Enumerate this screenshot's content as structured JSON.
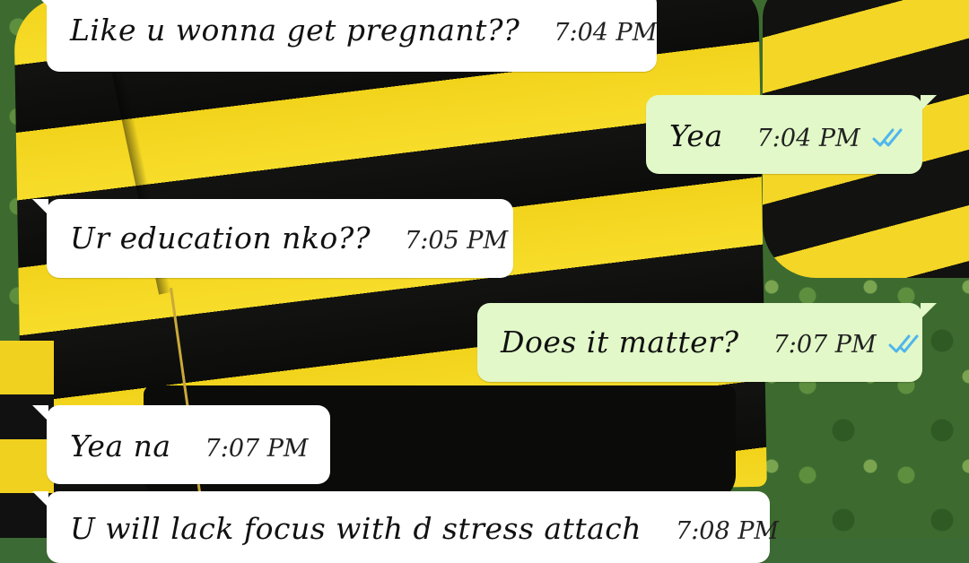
{
  "chat": {
    "messages": [
      {
        "direction": "incoming",
        "text": "Like u wonna get pregnant??",
        "time": "7:04 PM"
      },
      {
        "direction": "outgoing",
        "text": "Yea",
        "time": "7:04 PM",
        "status": "read"
      },
      {
        "direction": "incoming",
        "text": "Ur education nko??",
        "time": "7:05 PM"
      },
      {
        "direction": "outgoing",
        "text": "Does it matter?",
        "time": "7:07 PM",
        "status": "read"
      },
      {
        "direction": "incoming",
        "text": "Yea na",
        "time": "7:07 PM"
      },
      {
        "direction": "incoming",
        "text": "U will lack focus with d stress attach",
        "time": "7:08 PM"
      }
    ]
  },
  "colors": {
    "incoming_bubble": "#ffffff",
    "outgoing_bubble": "#e2f8c8",
    "read_ticks": "#4fb6ec"
  },
  "icons": {
    "read_receipt": "double-check-icon"
  }
}
